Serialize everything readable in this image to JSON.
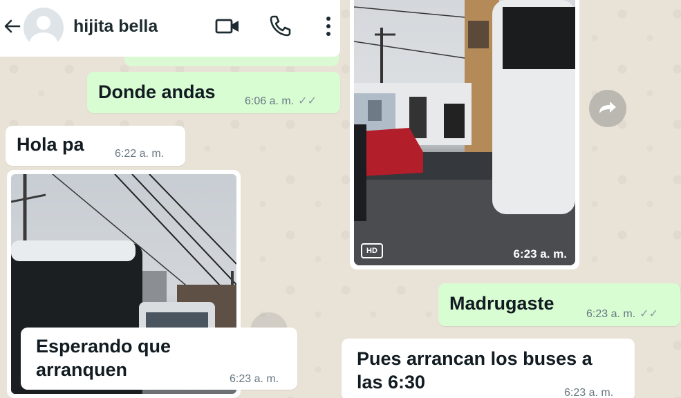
{
  "header": {
    "contact_name": "hijita bella",
    "back_icon": "arrow-left-icon",
    "video_icon": "video-camera-icon",
    "call_icon": "phone-icon",
    "menu_icon": "more-vertical-icon"
  },
  "messages": [
    {
      "direction": "out",
      "text": "Donde andas",
      "time": "6:06 a. m.",
      "status": "read"
    },
    {
      "direction": "in",
      "text": "Hola pa",
      "time": "6:22 a. m."
    },
    {
      "direction": "in",
      "type": "photo"
    },
    {
      "direction": "in",
      "text": "Esperando que arranquen",
      "time": "6:23 a. m."
    },
    {
      "direction": "in",
      "type": "photo",
      "badge": "HD",
      "time": "6:23 a. m."
    },
    {
      "direction": "out",
      "text": "Madrugaste",
      "time": "6:23 a. m.",
      "status": "read"
    },
    {
      "direction": "in",
      "text": "Pues arrancan los buses a las 6:30",
      "time": "6:23 a. m."
    }
  ],
  "colors": {
    "outgoing_bubble": "#d9fdd3",
    "incoming_bubble": "#ffffff",
    "chat_background": "#e9e2d6",
    "read_ticks": "#8696a0"
  }
}
